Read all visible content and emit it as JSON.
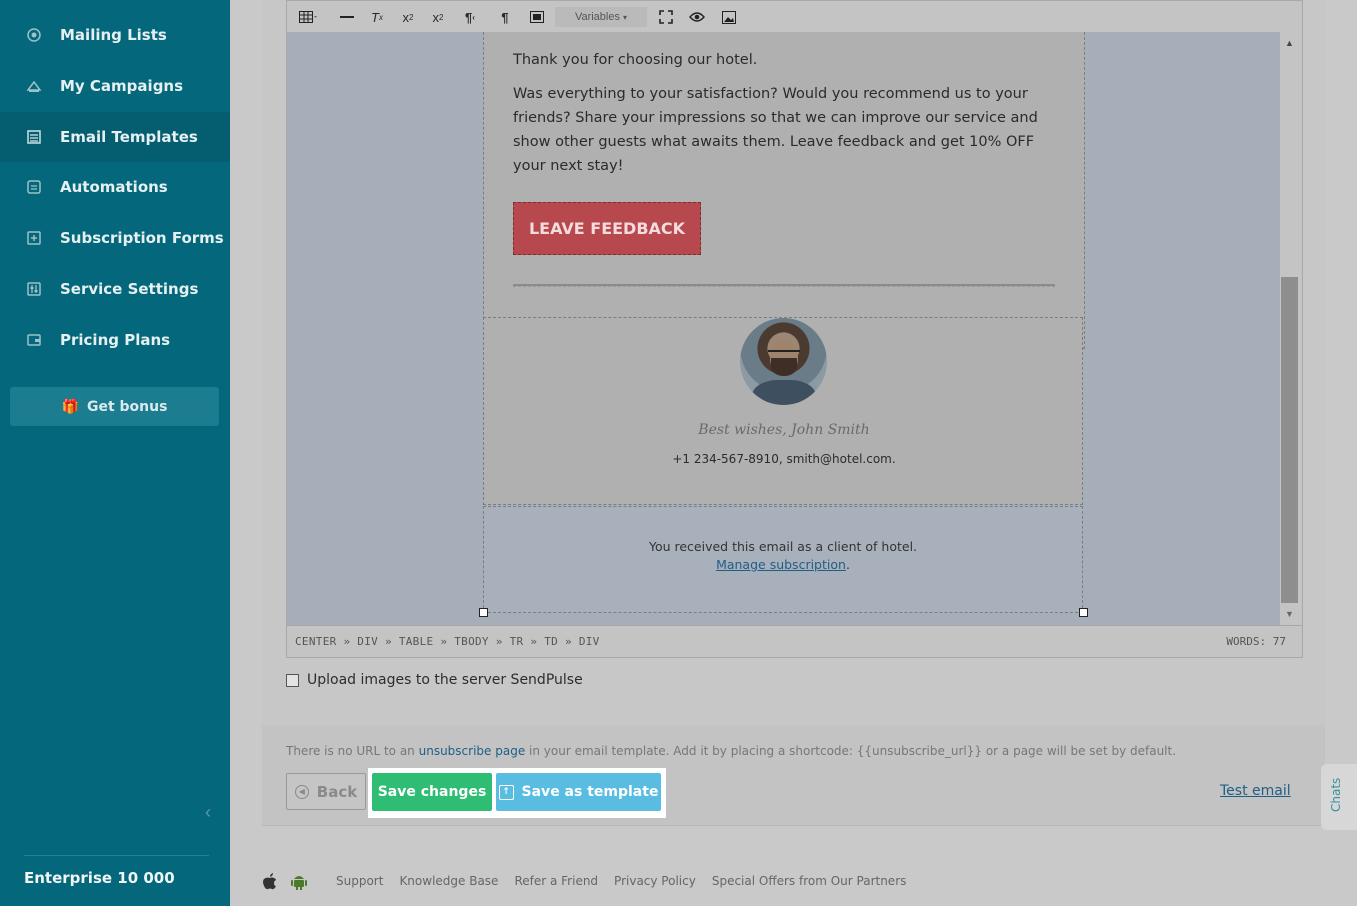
{
  "sidebar": {
    "items": [
      {
        "label": "Mailing Lists",
        "icon": "mailing-lists-icon"
      },
      {
        "label": "My Campaigns",
        "icon": "campaigns-icon"
      },
      {
        "label": "Email Templates",
        "icon": "templates-icon"
      },
      {
        "label": "Automations",
        "icon": "automations-icon"
      },
      {
        "label": "Subscription Forms",
        "icon": "forms-icon"
      },
      {
        "label": "Service Settings",
        "icon": "settings-icon"
      },
      {
        "label": "Pricing Plans",
        "icon": "pricing-icon"
      }
    ],
    "active_item": "Email Templates",
    "bonus_label": "Get bonus",
    "plan": "Enterprise 10 000"
  },
  "toolbar": {
    "variables_label": "Variables"
  },
  "email": {
    "greeting": "Thank you for choosing our hotel.",
    "body": "Was everything to your satisfaction? Would you recommend us to your friends? Share your impressions so that we can improve our service and show other guests what awaits them. Leave feedback and get 10% OFF your next stay!",
    "cta_label": "LEAVE FEEDBACK",
    "signature": "Best wishes, John Smith",
    "contact": "+1 234-567-8910, smith@hotel.com.",
    "footer_text": "You received this email as a client of hotel.",
    "manage_link": "Manage subscription",
    "manage_suffix": "."
  },
  "status_bar": {
    "path": "CENTER » DIV » TABLE » TBODY » TR » TD » DIV",
    "words": "WORDS: 77"
  },
  "upload_option": {
    "label": "Upload images to the server SendPulse",
    "checked": false
  },
  "notice": {
    "before": "There is no URL to an ",
    "link": "unsubscribe page",
    "after": " in your email template. Add it by placing a shortcode: {{unsubscribe_url}} or a page will be set by default."
  },
  "actions": {
    "back": "Back",
    "save": "Save changes",
    "save_template": "Save as template",
    "test_email": "Test email"
  },
  "chats_label": "Chats",
  "footer_links": [
    "Support",
    "Knowledge Base",
    "Refer a Friend",
    "Privacy Policy",
    "Special Offers from Our Partners"
  ],
  "colors": {
    "sidebar": "#04677b",
    "save_button": "#2ebd72",
    "template_button": "#58bde0",
    "cta": "#b7484e"
  }
}
